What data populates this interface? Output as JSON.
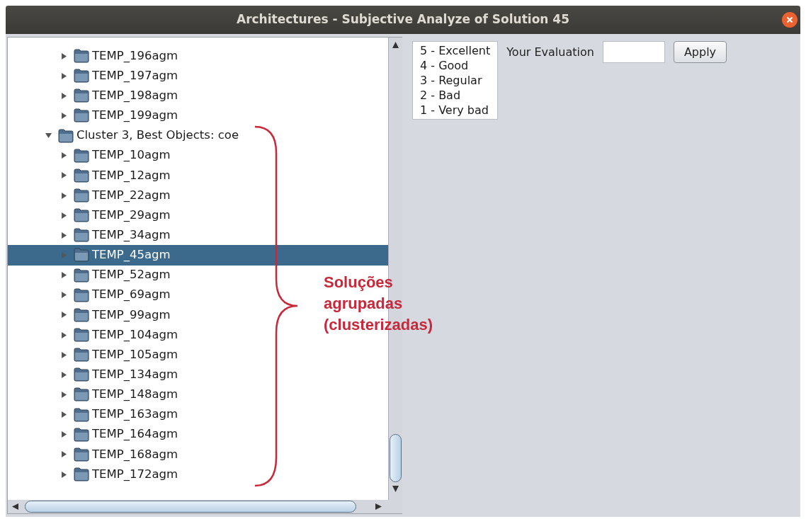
{
  "window": {
    "title": "Architectures - Subjective Analyze of Solution 45"
  },
  "tree": {
    "items": [
      {
        "children": [
          {
            "label": "TEMP_196agm",
            "expanded": false,
            "selected": false
          },
          {
            "label": "TEMP_197agm",
            "expanded": false,
            "selected": false
          },
          {
            "label": "TEMP_198agm",
            "expanded": false,
            "selected": false
          },
          {
            "label": "TEMP_199agm",
            "expanded": false,
            "selected": false
          }
        ]
      },
      {
        "label": "Cluster 3, Best Objects: coe",
        "expanded": true,
        "selected": false,
        "children": [
          {
            "label": "TEMP_10agm",
            "expanded": false,
            "selected": false
          },
          {
            "label": "TEMP_12agm",
            "expanded": false,
            "selected": false
          },
          {
            "label": "TEMP_22agm",
            "expanded": false,
            "selected": false
          },
          {
            "label": "TEMP_29agm",
            "expanded": false,
            "selected": false
          },
          {
            "label": "TEMP_34agm",
            "expanded": false,
            "selected": false
          },
          {
            "label": "TEMP_45agm",
            "expanded": false,
            "selected": true
          },
          {
            "label": "TEMP_52agm",
            "expanded": false,
            "selected": false
          },
          {
            "label": "TEMP_69agm",
            "expanded": false,
            "selected": false
          },
          {
            "label": "TEMP_99agm",
            "expanded": false,
            "selected": false
          },
          {
            "label": "TEMP_104agm",
            "expanded": false,
            "selected": false
          },
          {
            "label": "TEMP_105agm",
            "expanded": false,
            "selected": false
          },
          {
            "label": "TEMP_134agm",
            "expanded": false,
            "selected": false
          },
          {
            "label": "TEMP_148agm",
            "expanded": false,
            "selected": false
          },
          {
            "label": "TEMP_163agm",
            "expanded": false,
            "selected": false
          },
          {
            "label": "TEMP_164agm",
            "expanded": false,
            "selected": false
          },
          {
            "label": "TEMP_168agm",
            "expanded": false,
            "selected": false
          },
          {
            "label": "TEMP_172agm",
            "expanded": false,
            "selected": false
          }
        ]
      }
    ]
  },
  "rating_scale": [
    "5 - Excellent",
    "4 - Good",
    "3 - Regular",
    "2 - Bad",
    "1 - Very bad"
  ],
  "evaluation": {
    "label": "Your Evaluation",
    "button": "Apply"
  },
  "annotation": {
    "text": [
      "Soluções",
      "agrupadas",
      "(clusterizadas)"
    ]
  }
}
